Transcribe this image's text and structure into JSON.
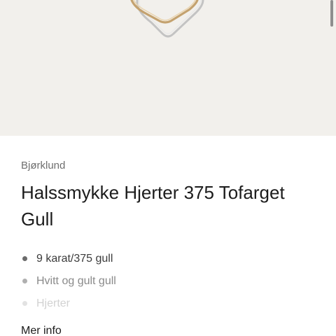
{
  "product": {
    "brand": "Bjørklund",
    "title": "Halssmykke Hjerter 375 Tofarget Gull",
    "features": [
      "9 karat/375 gull",
      "Hvitt og gult gull",
      "Hjerter"
    ],
    "more_info_label": "Mer info"
  },
  "colors": {
    "image_background": "#f2f0ec",
    "gold": "#c9a877",
    "white_gold": "#b9b9b9"
  },
  "icons": {
    "pendant": "heart-pendant-image"
  }
}
